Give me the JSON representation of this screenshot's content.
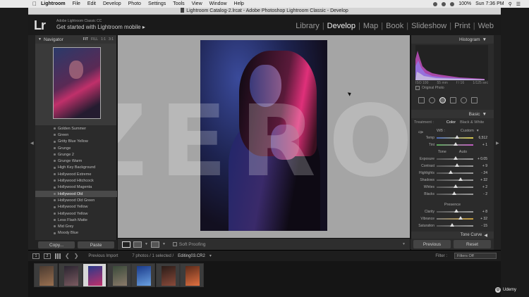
{
  "menubar": {
    "items": [
      "Lightroom",
      "File",
      "Edit",
      "Develop",
      "Photo",
      "Settings",
      "Tools",
      "View",
      "Window",
      "Help"
    ],
    "battery": "100%",
    "clock": "Sun 7:36 PM"
  },
  "window": {
    "title": "Lightroom Catalog-2.lrcat - Adobe Photoshop Lightroom Classic - Develop"
  },
  "identity": {
    "logo": "Lr",
    "product": "Adobe Lightroom Classic CC",
    "mobile": "Get started with Lightroom mobile",
    "modules": [
      "Library",
      "Develop",
      "Map",
      "Book",
      "Slideshow",
      "Print",
      "Web"
    ],
    "active_module": "Develop"
  },
  "navigator": {
    "title": "Navigator",
    "zooms": [
      "FIT",
      "FILL",
      "1:1",
      "3:1"
    ]
  },
  "presets": [
    "Golden Summer",
    "Green",
    "Gritty Blue Yellow",
    "Grunge",
    "Grunge 2",
    "Grunge Warm",
    "High Key Background",
    "Hollywood Extreme",
    "Hollywood Hitchcock",
    "Hollywood Magenta",
    "Hollywood Old",
    "Hollywood Old Green",
    "Hollywood Yellow",
    "Hollywood Yellow",
    "Less Flash Matte",
    "Mid Grey",
    "Moody Blue"
  ],
  "left_buttons": {
    "copy": "Copy...",
    "paste": "Paste"
  },
  "watermark": "ZERO",
  "toolbar": {
    "soft_proofing": "Soft Proofing"
  },
  "histogram": {
    "title": "Histogram",
    "info": [
      "ISO 100",
      "55 mm",
      "f / 16",
      "1/125 sec"
    ],
    "original_photo": "Original Photo"
  },
  "basic": {
    "title": "Basic",
    "treatment_label": "Treatment :",
    "color": "Color",
    "bw": "Black & White",
    "wb_label": "WB :",
    "wb_value": "Custom",
    "temp": {
      "label": "Temp",
      "value": "6,512",
      "pos": 0.56
    },
    "tint": {
      "label": "Tint",
      "value": "+ 1",
      "pos": 0.52
    },
    "tone_label": "Tone",
    "auto": "Auto",
    "exposure": {
      "label": "Exposure",
      "value": "+ 0.05",
      "pos": 0.51
    },
    "contrast": {
      "label": "Contrast",
      "value": "+ 9",
      "pos": 0.55
    },
    "highlights": {
      "label": "Highlights",
      "value": "- 24",
      "pos": 0.38
    },
    "shadows": {
      "label": "Shadows",
      "value": "+ 32",
      "pos": 0.66
    },
    "whites": {
      "label": "Whites",
      "value": "+ 2",
      "pos": 0.51
    },
    "blacks": {
      "label": "Blacks",
      "value": "- 2",
      "pos": 0.49
    },
    "presence_label": "Presence",
    "clarity": {
      "label": "Clarity",
      "value": "+ 8",
      "pos": 0.54
    },
    "vibrance": {
      "label": "Vibrance",
      "value": "+ 32",
      "pos": 0.66
    },
    "saturation": {
      "label": "Saturation",
      "value": "- 15",
      "pos": 0.42
    }
  },
  "tone_curve": {
    "title": "Tone Curve"
  },
  "right_buttons": {
    "previous": "Previous",
    "reset": "Reset"
  },
  "filmbar": {
    "pages": [
      "1",
      "2"
    ],
    "source": "Previous Import",
    "count": "7 photos / 1 selected /",
    "filename": "Editing03.CR2",
    "filter_label": "Filter :",
    "filter_value": "Filters Off"
  },
  "filmstrip": {
    "count": 7,
    "selected_index": 2,
    "colors": [
      [
        "#4a3a30",
        "#9a7050"
      ],
      [
        "#2a2430",
        "#7a5a60"
      ],
      [
        "#2a3a8a",
        "#c0306a"
      ],
      [
        "#3a4a3a",
        "#8a7a6a"
      ],
      [
        "#1a3a8a",
        "#6aa0e0"
      ],
      [
        "#2a1c18",
        "#8a4a3a"
      ],
      [
        "#5a2a1a",
        "#e07040"
      ]
    ]
  },
  "udemy": "Udemy"
}
